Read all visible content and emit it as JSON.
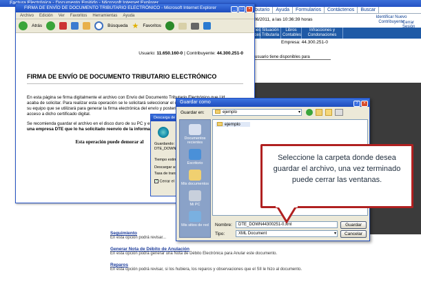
{
  "bg": {
    "window_title": "Factura Electrónica - Documento Emitido - Microsoft Internet Explorer",
    "nav": [
      "Tributario",
      "Ayuda",
      "Formularios",
      "Contáctenos",
      "Buscar"
    ],
    "datetime": "06/2011, a las 10:36:39 horas",
    "id_link": "Identificar Nuevo Contribuyente",
    "close_session": "Cerrar Sesión",
    "subtabs": [
      "Bienes Raíces",
      "Situación Tributaria",
      "Libros Contables",
      "Infracciones y Condonaciones"
    ],
    "empresa": "Empresa: 44.300.251-0",
    "partial_text": "usuario tiene disponibles para",
    "links": [
      {
        "title": "Seguimiento",
        "desc": "En esta opción podrá revisar..."
      },
      {
        "title": "Generar Nota de Débito de Anulación",
        "desc": "En esta opción podrá generar una Nota de Débito Electrónica para Anular este documento."
      },
      {
        "title": "Reparos",
        "desc": "En esta opción podrá revisar, si los hubiera, los reparos y observaciones que el SII le hizo al documento."
      }
    ]
  },
  "ie": {
    "title": "FIRMA DE ENVÍO DE DOCUMENTO TRIBUTARIO ELECTRÓNICO - Microsoft Internet Explorer",
    "menu": [
      "Archivo",
      "Edición",
      "Ver",
      "Favoritos",
      "Herramientas",
      "Ayuda"
    ],
    "toolbar": {
      "back": "Atrás",
      "search": "Búsqueda",
      "favorites": "Favoritos"
    },
    "usuario_label": "Usuario:",
    "usuario": "11.650.160-0",
    "contrib_label": "| Contribuyente:",
    "contrib": "44.300.251-0",
    "heading": "FIRMA DE ENVÍO DE DOCUMENTO TRIBUTARIO ELECTRÓNICO",
    "p1": "En esta página se firma digitalmente el archivo con Envío del Documento Tributario Electrónico que Ud. acaba de solicitar. Para realizar esta operación se le solicitará seleccionar el certificado digital instalado en su equipo que se utilizará para generar la firma electrónica del envío y posteriormente ingresar la clave de acceso a dicho certificado digital.",
    "p2a": "Se recomienda guardar el archivo en el disco duro de su PC y enviarlo a",
    "p2b": "una empresa DTE que lo ha solicitado reenvío de la información",
    "warning": "Esta operación puede demorar al"
  },
  "dl": {
    "title": "Descarga de archivos",
    "saving": "Guardando:",
    "file": "DTE_DOWN",
    "time_left": "Tiempo estima",
    "download_to": "Descargar a:",
    "rate": "Tasa de transf",
    "close_when_done": "Cerrar el"
  },
  "sv": {
    "title": "Guardar como",
    "save_in_label": "Guardar en:",
    "save_in_value": "ejemplo",
    "list_item": "ejemplo",
    "places": [
      "Documentos recientes",
      "Escritorio",
      "Mis documentos",
      "Mi PC",
      "Mis sitios de red"
    ],
    "name_label": "Nombre:",
    "name_value": "DTE_DOWN44300251-0.xml",
    "type_label": "Tipo:",
    "type_value": "XML Document",
    "save_btn": "Guardar",
    "cancel_btn": "Cancelar"
  },
  "callout": "Seleccione la carpeta donde desea guardar el archivo, una vez terminado puede cerrar las ventanas."
}
